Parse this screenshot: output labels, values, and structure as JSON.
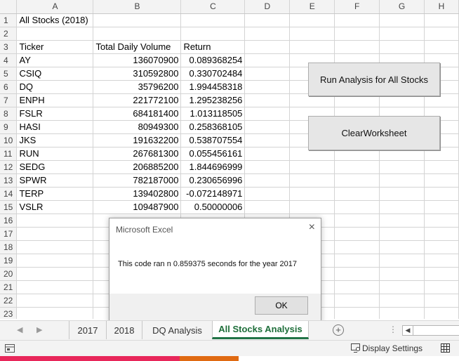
{
  "sheet": {
    "columns": [
      "A",
      "B",
      "C",
      "D",
      "E",
      "F",
      "G",
      "H"
    ],
    "rows": [
      {
        "n": "1",
        "a": "All Stocks (2018)",
        "b": "",
        "c": ""
      },
      {
        "n": "2",
        "a": "",
        "b": "",
        "c": ""
      },
      {
        "n": "3",
        "a": "Ticker",
        "b": "Total Daily Volume",
        "c": "Return"
      },
      {
        "n": "4",
        "a": "AY",
        "b": "136070900",
        "c": "0.089368254"
      },
      {
        "n": "5",
        "a": "CSIQ",
        "b": "310592800",
        "c": "0.330702484"
      },
      {
        "n": "6",
        "a": "DQ",
        "b": "35796200",
        "c": "1.994458318"
      },
      {
        "n": "7",
        "a": "ENPH",
        "b": "221772100",
        "c": "1.295238256"
      },
      {
        "n": "8",
        "a": "FSLR",
        "b": "684181400",
        "c": "1.013118505"
      },
      {
        "n": "9",
        "a": "HASI",
        "b": "80949300",
        "c": "0.258368105"
      },
      {
        "n": "10",
        "a": "JKS",
        "b": "191632200",
        "c": "0.538707554"
      },
      {
        "n": "11",
        "a": "RUN",
        "b": "267681300",
        "c": "0.055456161"
      },
      {
        "n": "12",
        "a": "SEDG",
        "b": "206885200",
        "c": "1.844696999"
      },
      {
        "n": "13",
        "a": "SPWR",
        "b": "782187000",
        "c": "0.230656996"
      },
      {
        "n": "14",
        "a": "TERP",
        "b": "139402800",
        "c": "-0.072148971"
      },
      {
        "n": "15",
        "a": "VSLR",
        "b": "109487900",
        "c": "0.50000006"
      },
      {
        "n": "16",
        "a": "",
        "b": "",
        "c": ""
      },
      {
        "n": "17",
        "a": "",
        "b": "",
        "c": ""
      },
      {
        "n": "18",
        "a": "",
        "b": "",
        "c": ""
      },
      {
        "n": "19",
        "a": "",
        "b": "",
        "c": ""
      },
      {
        "n": "20",
        "a": "",
        "b": "",
        "c": ""
      },
      {
        "n": "21",
        "a": "",
        "b": "",
        "c": ""
      },
      {
        "n": "22",
        "a": "",
        "b": "",
        "c": ""
      },
      {
        "n": "23",
        "a": "",
        "b": "",
        "c": ""
      }
    ]
  },
  "buttons": {
    "run_label": "Run Analysis for All Stocks",
    "clear_label": "ClearWorksheet"
  },
  "dialog": {
    "title": "Microsoft Excel",
    "message": "This code ran n 0.859375 seconds for the year 2017",
    "ok_label": "OK",
    "close_icon": "×"
  },
  "tabs": [
    {
      "label": "2017",
      "active": false
    },
    {
      "label": "2018",
      "active": false
    },
    {
      "label": "DQ Analysis",
      "active": false
    },
    {
      "label": "All Stocks Analysis",
      "active": true
    }
  ],
  "tabbar": {
    "prev_icon": "◀",
    "next_icon": "▶",
    "add_icon": "+",
    "more_icon": "⋮"
  },
  "status": {
    "display_settings": "Display Settings"
  },
  "colors": {
    "accent": "#217346",
    "stripe_pink": "#e8275a",
    "stripe_orange": "#e06a12"
  }
}
